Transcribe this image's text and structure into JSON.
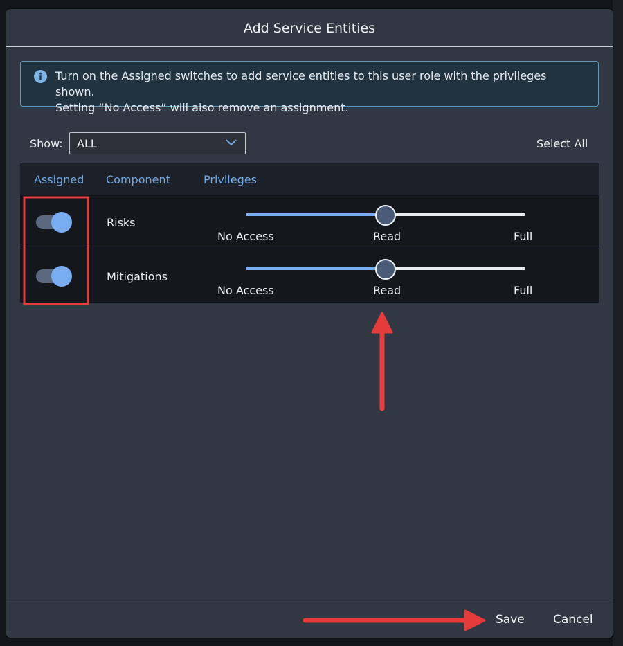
{
  "dialog": {
    "title": "Add Service Entities"
  },
  "info": {
    "icon": "info-icon",
    "line1": "Turn on the Assigned switches to add service entities to this user role with the privileges shown.",
    "line2": "Setting “No Access” will also remove an assignment."
  },
  "filter": {
    "label": "Show:",
    "selected": "ALL",
    "select_all": "Select All"
  },
  "table": {
    "columns": [
      "Assigned",
      "Component",
      "Privileges"
    ],
    "privilege_levels": [
      "No Access",
      "Read",
      "Full"
    ],
    "rows": [
      {
        "assigned": true,
        "component": "Risks",
        "privilege": "Read",
        "privilege_fraction": 0.5
      },
      {
        "assigned": true,
        "component": "Mitigations",
        "privilege": "Read",
        "privilege_fraction": 0.5
      }
    ]
  },
  "footer": {
    "save_label": "Save",
    "cancel_label": "Cancel"
  },
  "colors": {
    "accent": "#78aef0",
    "annotation": "#e53b3b",
    "dialog_bg": "#323843"
  }
}
